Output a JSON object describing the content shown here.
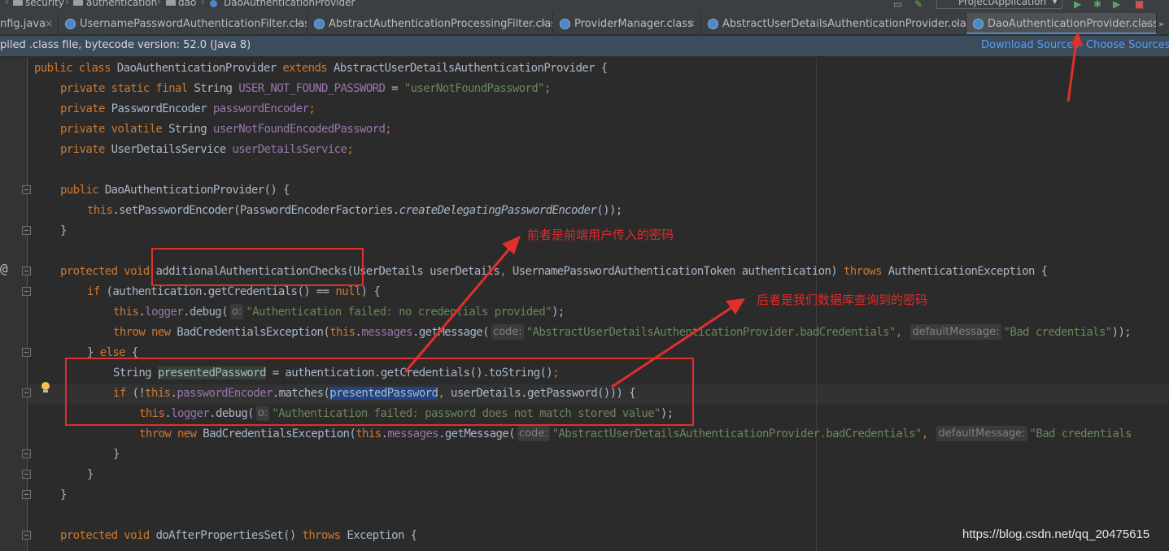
{
  "breadcrumb": [
    "security",
    "authentication",
    "dao",
    "DaoAuthenticationProvider"
  ],
  "run_config": "ProjectApplication",
  "tabs": [
    {
      "label": "nfig.java",
      "active": false
    },
    {
      "label": "UsernamePasswordAuthenticationFilter.class",
      "active": false
    },
    {
      "label": "AbstractAuthenticationProcessingFilter.class",
      "active": false
    },
    {
      "label": "ProviderManager.class",
      "active": false
    },
    {
      "label": "AbstractUserDetailsAuthenticationProvider.class",
      "active": false
    },
    {
      "label": "DaoAuthenticationProvider.class",
      "active": true
    }
  ],
  "tab_overflow": "»",
  "notice": {
    "text": "piled .class file, bytecode version: 52.0 (Java 8)",
    "download_sources": "Download Sources",
    "choose_sources": "Choose Sources..."
  },
  "code": {
    "l1": {
      "a": "public class ",
      "b": "DaoAuthenticationProvider ",
      "c": "extends ",
      "d": "AbstractUserDetailsAuthenticationProvider {"
    },
    "l2": {
      "a": "private static final ",
      "b": "String ",
      "c": "USER_NOT_FOUND_PASSWORD",
      "d": " = ",
      "e": "\"userNotFoundPassword\"",
      "f": ";"
    },
    "l3": {
      "a": "private ",
      "b": "PasswordEncoder ",
      "c": "passwordEncoder",
      "d": ";"
    },
    "l4": {
      "a": "private volatile ",
      "b": "String ",
      "c": "userNotFoundEncodedPassword",
      "d": ";"
    },
    "l5": {
      "a": "private ",
      "b": "UserDetailsService ",
      "c": "userDetailsService",
      "d": ";"
    },
    "l7": {
      "a": "public ",
      "b": "DaoAuthenticationProvider() {"
    },
    "l8": {
      "a": "this",
      "b": ".setPasswordEncoder(PasswordEncoderFactories.",
      "c": "createDelegatingPasswordEncoder",
      "d": "());"
    },
    "l9": {
      "a": "}"
    },
    "l11": {
      "a": "protected void ",
      "b": "additionalAuthenticationChecks",
      "c": "(UserDetails userDetails",
      "d": ", ",
      "e": "UsernamePasswordAuthenticationToken authentication) ",
      "f": "throws ",
      "g": "AuthenticationException {"
    },
    "l12": {
      "a": "if ",
      "b": "(authentication.getCredentials() == ",
      "c": "null",
      "d": ") {"
    },
    "l13": {
      "a": "this",
      "b": ".",
      "c": "logger",
      "d": ".debug(",
      "hint": "o:",
      "e": "\"Authentication failed: no credentials provided\"",
      "f": ");"
    },
    "l14": {
      "a": "throw new ",
      "b": "BadCredentialsException(",
      "c": "this",
      "d": ".",
      "e": "messages",
      "f": ".getMessage(",
      "hint1": "code:",
      "g": "\"AbstractUserDetailsAuthenticationProvider.badCredentials\"",
      "h": ", ",
      "hint2": "defaultMessage:",
      "i": "\"Bad credentials\"",
      "j": "));"
    },
    "l15": {
      "a": "} ",
      "b": "else ",
      "c": "{"
    },
    "l16": {
      "a": "String ",
      "b": "presentedPassword",
      "c": " = authentication.getCredentials().toString()",
      "d": ";"
    },
    "l17": {
      "a": "if ",
      "b": "(!",
      "c": "this",
      "d": ".",
      "e": "passwordEncoder",
      "f": ".matches(",
      "g": "presentedPassword",
      "h": ", ",
      "i": "userDetails.getPassword())) {"
    },
    "l18": {
      "a": "this",
      "b": ".",
      "c": "logger",
      "d": ".debug(",
      "hint": "o:",
      "e": "\"Authentication failed: password does not match stored value\"",
      "f": ");"
    },
    "l19": {
      "a": "throw new ",
      "b": "BadCredentialsException(",
      "c": "this",
      "d": ".",
      "e": "messages",
      "f": ".getMessage(",
      "hint1": "code:",
      "g": "\"AbstractUserDetailsAuthenticationProvider.badCredentials\"",
      "h": ", ",
      "hint2": "defaultMessage:",
      "i": "\"Bad credentials"
    },
    "l20": {
      "a": "}"
    },
    "l21": {
      "a": "}"
    },
    "l22": {
      "a": "}"
    },
    "l24": {
      "a": "protected void ",
      "b": "doAfterPropertiesSet() ",
      "c": "throws ",
      "d": "Exception {"
    }
  },
  "annotations": {
    "first": "前者是前端用户传入的密码",
    "second": "后者是我们数据库查询到的密码",
    "color": "#e0302b"
  },
  "watermark": "https://blog.csdn.net/qq_20475615",
  "colors": {
    "keyword": "#cc7832",
    "string": "#6a8759",
    "field": "#9876aa",
    "text": "#a9b7c6",
    "link": "#589df6"
  }
}
